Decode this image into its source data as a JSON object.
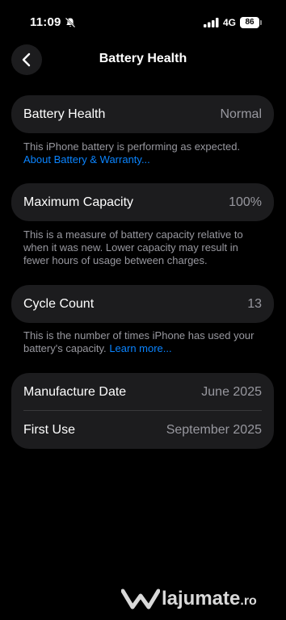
{
  "status_bar": {
    "time": "11:09",
    "network": "4G",
    "battery_level": "86",
    "icons": [
      "bell-slash-icon",
      "signal-icon",
      "battery-icon"
    ]
  },
  "nav": {
    "title": "Battery Health",
    "back_icon": "chevron-left-icon"
  },
  "sections": {
    "health": {
      "label": "Battery Health",
      "value": "Normal",
      "footnote": "This iPhone battery is performing as expected.",
      "link": "About Battery & Warranty..."
    },
    "capacity": {
      "label": "Maximum Capacity",
      "value": "100%",
      "footnote": "This is a measure of battery capacity relative to when it was new. Lower capacity may result in fewer hours of usage between charges."
    },
    "cycles": {
      "label": "Cycle Count",
      "value": "13",
      "footnote": "This is the number of times iPhone has used your battery's capacity.",
      "link": "Learn more..."
    },
    "dates": {
      "manufacture_label": "Manufacture Date",
      "manufacture_value": "June 2025",
      "first_use_label": "First Use",
      "first_use_value": "September 2025"
    }
  },
  "watermark": {
    "text": "lajumate",
    "tld": ".ro"
  },
  "colors": {
    "background": "#000000",
    "card": "#1c1c1e",
    "secondary_text": "#98989f",
    "link": "#0a84ff"
  }
}
